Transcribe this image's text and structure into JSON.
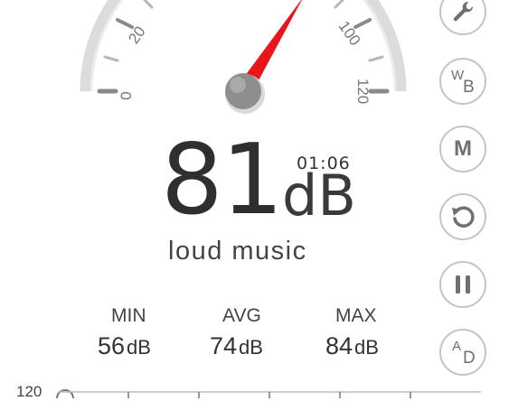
{
  "gauge": {
    "scale_labels": [
      "0",
      "20",
      "100",
      "120"
    ],
    "needle_value_db": 81,
    "colors": {
      "needle": "#e8151b",
      "arc": "#d8d8d8",
      "ticks": "#8a8a8a",
      "hub": "#888888"
    }
  },
  "reading": {
    "value": "81",
    "unit": "dB",
    "timer": "01:06",
    "description": "loud music"
  },
  "stats": [
    {
      "label": "MIN",
      "value": "56",
      "unit": "dB"
    },
    {
      "label": "AVG",
      "value": "74",
      "unit": "dB"
    },
    {
      "label": "MAX",
      "value": "84",
      "unit": "dB"
    }
  ],
  "side_buttons": [
    {
      "name": "settings-button",
      "icon": "wrench-icon"
    },
    {
      "name": "weighting-button",
      "icon": "wb-icon",
      "text_main": "W",
      "text_sub": "B"
    },
    {
      "name": "mode-button",
      "icon": "m-icon",
      "label": "M"
    },
    {
      "name": "reset-button",
      "icon": "refresh-icon"
    },
    {
      "name": "pause-button",
      "icon": "pause-icon"
    },
    {
      "name": "ad-button",
      "icon": "ad-icon",
      "text_main": "A",
      "text_sub": "D"
    }
  ],
  "graph": {
    "y_top_label": "120"
  }
}
